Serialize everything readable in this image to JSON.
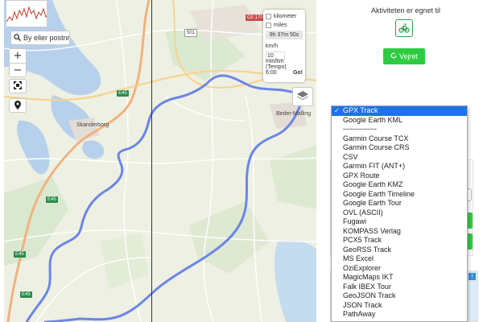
{
  "map": {
    "search_placeholder": "By eller postnr",
    "zoom_in": "+",
    "zoom_out": "−",
    "units": {
      "km_label": "kilometer",
      "miles_label": "miles",
      "duration": "9h 37m 50s",
      "speed_unit": "km/h",
      "speed_value": "10",
      "pace_label": "min/km (Tempo)",
      "pace_value": "6:00",
      "go_label": "Go!"
    },
    "labels": {
      "town_west": "Skanderborg",
      "town_east": "Beder-Malling",
      "road_e45_a": "E45",
      "road_e45_b": "E45",
      "road_e45_c": "E45",
      "road_e45_d": "E45",
      "road_501": "501",
      "road_o2": "O2 170"
    },
    "icons": {
      "search": "search-icon",
      "fullscreen": "fullscreen-icon",
      "location": "location-pin-icon",
      "layers": "layers-icon"
    },
    "track_color": "#6b86e8"
  },
  "activity": {
    "suited_for_title": "Aktiviteten er egnet til",
    "bike_icon": "bicycle-icon",
    "weather_button": "Vejret",
    "accent_color": "#2ecc40"
  },
  "format_dropdown": {
    "selected": "GPX Track",
    "options": [
      "GPX Track",
      "Google Earth KML",
      "--------------",
      "Garmin Course TCX",
      "Garmin Course CRS",
      "CSV",
      "Garmin FIT (ANT+)",
      "GPX Route",
      "Google Earth KMZ",
      "Google Earth Timeline",
      "Google Earth Tour",
      "OVL (ASCII)",
      "Fugawi",
      "KOMPASS Verlag",
      "PCX5 Track",
      "GeoRSS Track",
      "MS Excel",
      "OziExplorer",
      "MagicMaps IKT",
      "Falk IBEX Tour",
      "GeoJSON Track",
      "JSON Track",
      "PathAway"
    ]
  }
}
